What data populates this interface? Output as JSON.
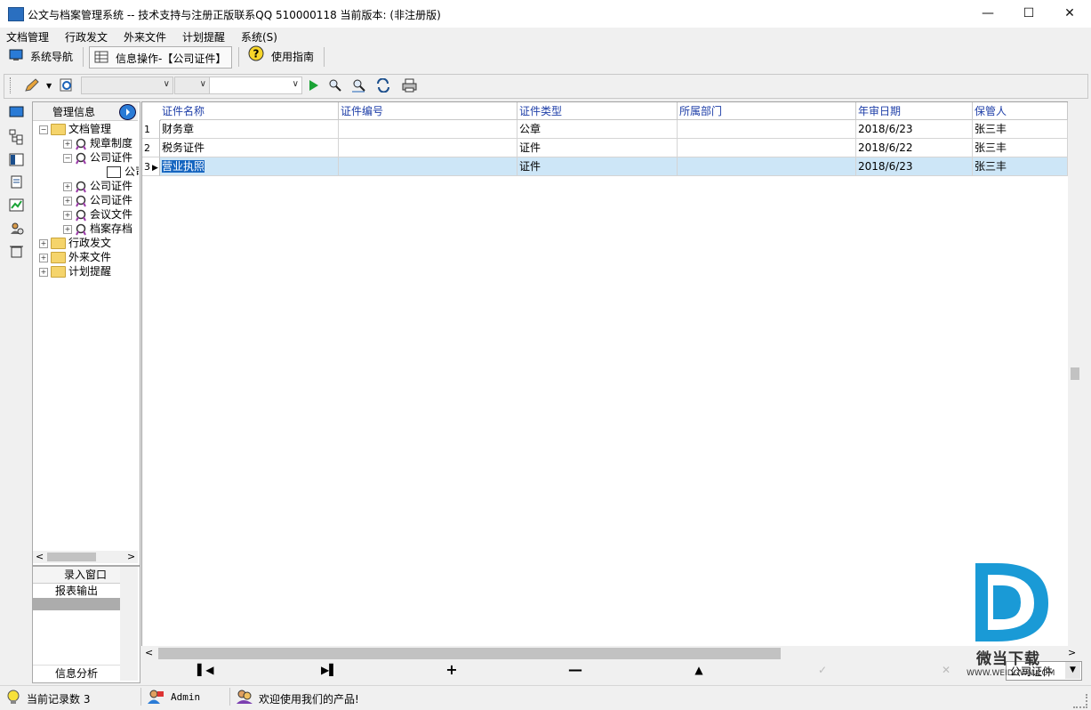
{
  "window": {
    "title": "公文与档案管理系统 -- 技术支持与注册正版联系QQ 510000118    当前版本:  (非注册版)"
  },
  "menu": [
    "文档管理",
    "行政发文",
    "外来文件",
    "计划提醒",
    "系统(S)"
  ],
  "tabs": {
    "nav": "系统导航",
    "info": "信息操作-【公司证件】",
    "guide": "使用指南"
  },
  "tree": {
    "header": "管理信息",
    "nodes": {
      "docmgmt": "文档管理",
      "rules": "规章制度",
      "company_cert": "公司证件",
      "company_cert_child": "公司证件",
      "n4": "公司证件",
      "n5": "公司证件",
      "meeting": "会议文件",
      "archive": "档案存档",
      "admin_doc": "行政发文",
      "incoming": "外来文件",
      "plan": "计划提醒"
    }
  },
  "nav_panel": {
    "entry": "录入窗口",
    "report": "报表输出",
    "analysis": "信息分析"
  },
  "grid": {
    "columns": [
      "证件名称",
      "证件编号",
      "证件类型",
      "所属部门",
      "年审日期",
      "保管人"
    ],
    "rows": [
      {
        "n": "1",
        "name": "财务章",
        "code": "",
        "type": "公章",
        "dept": "",
        "date": "2018/6/23",
        "keeper": "张三丰"
      },
      {
        "n": "2",
        "name": "税务证件",
        "code": "",
        "type": "证件",
        "dept": "",
        "date": "2018/6/22",
        "keeper": "张三丰"
      },
      {
        "n": "3",
        "name": "营业执照",
        "code": "",
        "type": "证件",
        "dept": "",
        "date": "2018/6/23",
        "keeper": "张三丰"
      }
    ]
  },
  "filter_combo": "公司证件",
  "status": {
    "record_count": "当前记录数 3",
    "user": "Admin",
    "welcome": "欢迎使用我们的产品!"
  },
  "watermark": {
    "text": "微当下载",
    "url": "WWW.WEIDOWN.COM"
  },
  "colors": {
    "selection": "#cde6f7",
    "header_text": "#1f3fa8",
    "watermark": "#1a9ad6"
  }
}
